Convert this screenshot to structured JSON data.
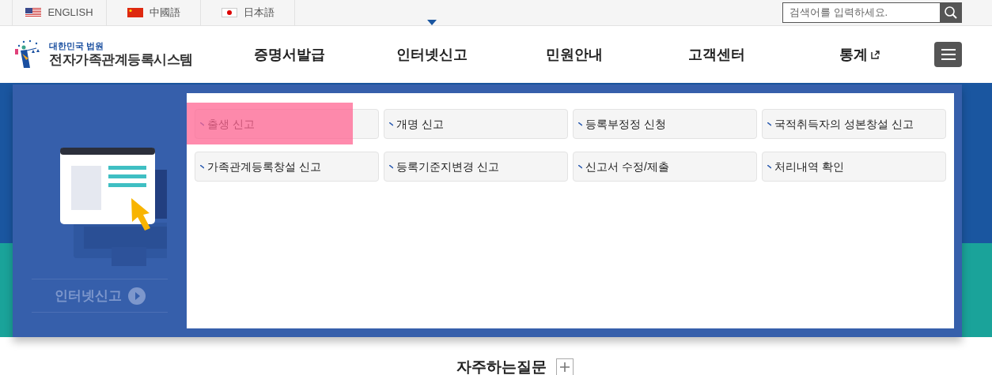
{
  "language_links": [
    {
      "label": "ENGLISH",
      "kind": "us"
    },
    {
      "label": "中國語",
      "kind": "cn"
    },
    {
      "label": "日本語",
      "kind": "jp"
    }
  ],
  "search": {
    "placeholder": "검색어를 입력하세요."
  },
  "logo": {
    "subtitle": "대한민국 법원",
    "title": "전자가족관계등록시스템"
  },
  "nav": [
    {
      "label": "증명서발급",
      "selected": false,
      "external": false
    },
    {
      "label": "인터넷신고",
      "selected": true,
      "external": false
    },
    {
      "label": "민원안내",
      "selected": false,
      "external": false
    },
    {
      "label": "고객센터",
      "selected": false,
      "external": false
    },
    {
      "label": "통계",
      "selected": false,
      "external": true
    }
  ],
  "submenu": {
    "caption": "인터넷신고",
    "items": [
      {
        "label": "출생 신고",
        "highlighted": true
      },
      {
        "label": "개명 신고",
        "highlighted": false
      },
      {
        "label": "등록부정정 신청",
        "highlighted": false
      },
      {
        "label": "국적취득자의 성본창설 신고",
        "highlighted": false
      },
      {
        "label": "가족관계등록창설 신고",
        "highlighted": false
      },
      {
        "label": "등록기준지변경 신고",
        "highlighted": false
      },
      {
        "label": "신고서 수정/제출",
        "highlighted": false
      },
      {
        "label": "처리내역 확인",
        "highlighted": false
      }
    ]
  },
  "faq": {
    "title": "자주하는질문"
  }
}
